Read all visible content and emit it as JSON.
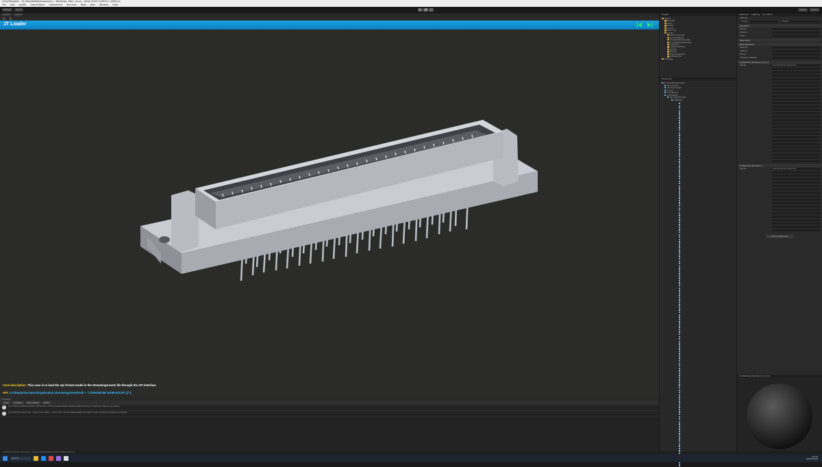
{
  "window": {
    "title": "UnityPJLoader - PJ_SimpleModelsample(1) - Windows, Mac, Linux - Unity 2022.3.20f1c1 <DX11>",
    "menu": [
      "File",
      "Edit",
      "Assets",
      "GameObject",
      "Component",
      "Services",
      "Tools",
      "Jobs",
      "Window",
      "Help"
    ]
  },
  "toolbar": {
    "account": "Default",
    "buttons": [
      "Account",
      "Cloud",
      "Layers",
      "Layout"
    ]
  },
  "scene": {
    "tabs": [
      "Scene",
      "Game"
    ],
    "banner_title": "JT Loader",
    "case_label": "Case description:",
    "case_text": "This case is to load the stp format model in the StreamingAssets file through the API interface.",
    "api_label": "API:",
    "api_text": "LAStImporter.Import(Application.streamingAssetsPath + \"/JTModel/3M-10268-6212PC.jt\");",
    "accent": "#1ba0e0"
  },
  "console": {
    "tab": "Console",
    "toolbar": [
      "Clear",
      "Collapse",
      "Error Pause",
      "Editor"
    ],
    "logs": [
      "[13:22:45] LoadModel finished. JT(F:\\Users\\...\\StreamingAssets\\JTModel\\3M-10268-6212PC.jt)\nUnityEngine.Debug:Log (object)",
      "[13:22:45] Process model : Tiling 'scene object', radius 'bbox' StreamingAssetsPath sub object model\nUnityEngine.Debug:Log (object)"
    ]
  },
  "status": "LoadModel finished. JT(F:\\Users\\...\\StreamingAssets\\JTModel\\3M-10268-6212PC.jt)",
  "project": {
    "header": "Project",
    "items": [
      "Assets",
      "JTLoader",
      "Editor",
      "Models",
      "Scenes",
      "Resources",
      "Scripts",
      "StreamingAssets",
      "JT_SimpleModel",
      "JT_SimpleModelsample",
      "JT_SimpleModelsample2",
      "UI_Module",
      "Lighting Settings",
      "Sample",
      "Plugins",
      "StreamingAssets",
      "TextMesh Pro",
      "Packages"
    ]
  },
  "hierarchy": {
    "header": "Hierarchy",
    "items": [
      "JT_SimpleModelsample*",
      "Main Camera",
      "Directional Light",
      "Canvas",
      "EventSystem",
      "JTModelRoot",
      "3M-10268-6212PC",
      "00000001"
    ]
  },
  "inspector": {
    "tabs": [
      "Inspector",
      "Lighting",
      "Occlusion"
    ],
    "object_name": "JTPlaneP",
    "tag": "Untagged",
    "layer": "Default",
    "sections": [
      "Transform",
      "Mesh Filter",
      "Mesh Renderer",
      "Materials",
      "Lighting",
      "Probes",
      "Additional Settings"
    ],
    "material1": "JT_Material_Standard_0_0_0_0",
    "material2": "JT_Material_Standard_1",
    "shader": "Universal Render Pipeline/Lit",
    "add_component": "Add Component",
    "preview_title": "JT_Material_Standard_0_0_0_0"
  },
  "taskbar": {
    "search": "Search",
    "time": "13:25",
    "date": "2024/03/26"
  }
}
